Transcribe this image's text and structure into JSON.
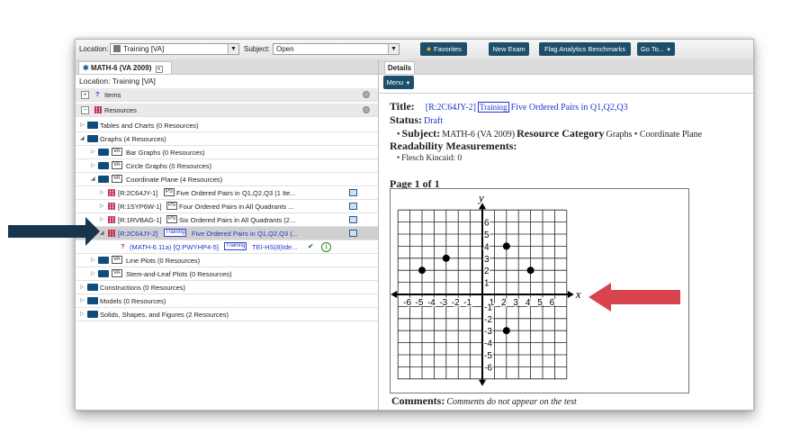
{
  "toolbar": {
    "location_label": "Location:",
    "location_value": "Training [VA]",
    "subject_label": "Subject:",
    "subject_value": "Open",
    "favorites": "Favorites",
    "new_exam": "New Exam",
    "flag_benchmarks": "Flag Analytics Benchmarks",
    "go_to": "Go To..."
  },
  "left": {
    "tab": "MATH-6 (VA 2009)",
    "location": "Location: Training [VA]",
    "items_header": "Items",
    "resources_header": "Resources",
    "tree": [
      {
        "text": "Tables and Charts (0 Resources)"
      },
      {
        "text": "Graphs (4 Resources)"
      },
      {
        "text": "Bar Graphs (0 Resources)"
      },
      {
        "text": "Circle Graphs (0 Resources)"
      },
      {
        "text": "Coordinate Plane (4 Resources)"
      },
      {
        "code": "[R:2C64JY-1]",
        "text": "Five Ordered Pairs in Q1,Q2,Q3 (1 Ite..."
      },
      {
        "code": "[R:1SYP6W-1]",
        "text": "Four Ordered Pairs in All Quadrants ..."
      },
      {
        "code": "[R:1RVBAG-1]",
        "text": "Six Ordered Pairs in All Quadrants (2..."
      },
      {
        "code": "[R:2C64JY-2]",
        "text": "Five Ordered Pairs in Q1,Q2,Q3 (..."
      },
      {
        "code": "(MATH-6.11a) [Q:PWYHP4-5]",
        "text": "TEI-HS(8)Ide..."
      },
      {
        "text": "Line Plots (0 Resources)"
      },
      {
        "text": "Stem-and-Leaf Plots (0 Resources)"
      },
      {
        "text": "Constructions (0 Resources)"
      },
      {
        "text": "Models (0 Resources)"
      },
      {
        "text": "Solids, Shapes, and Figures (2 Resources)"
      }
    ],
    "va_badge": "VA",
    "ps_badge": "PS",
    "training_badge": "Training",
    "green_count": "1"
  },
  "details": {
    "tab": "Details",
    "menu": "Menu",
    "title_label": "Title:",
    "title_code": "[R:2C64JY-2]",
    "title_badge": "Training",
    "title_text": "Five Ordered Pairs in Q1,Q2,Q3",
    "status_label": "Status:",
    "status_value": "Draft",
    "subject_label": "Subject:",
    "subject_value": "MATH-6 (VA 2009)",
    "category_label": "Resource Category",
    "category_value": "Graphs • Coordinate Plane",
    "readability": "Readability Measurements:",
    "flesch": "Flesch Kincaid: 0",
    "page": "Page 1 of 1",
    "comments_label": "Comments:",
    "comments_value": "Comments do not appear on the test"
  },
  "chart_data": {
    "type": "scatter",
    "xlabel": "x",
    "ylabel": "y",
    "xlim": [
      -7,
      7
    ],
    "ylim": [
      -7,
      7
    ],
    "grid": true,
    "x_ticks": [
      "-6",
      "-5",
      "-4",
      "-3",
      "-2",
      "-1",
      "1",
      "2",
      "3",
      "4",
      "5",
      "6"
    ],
    "y_ticks": [
      "6",
      "5",
      "4",
      "3",
      "2",
      "1",
      "-1",
      "-2",
      "-3",
      "-4",
      "-5",
      "-6"
    ],
    "points": [
      {
        "x": -5,
        "y": 2
      },
      {
        "x": -3,
        "y": 3
      },
      {
        "x": 2,
        "y": 4
      },
      {
        "x": 4,
        "y": 2
      },
      {
        "x": 2,
        "y": -3
      }
    ]
  },
  "colors": {
    "button_bg": "#1d4f6b",
    "left_arrow": "#17364d",
    "right_arrow": "#d9454f",
    "link_blue": "#2233cc"
  }
}
